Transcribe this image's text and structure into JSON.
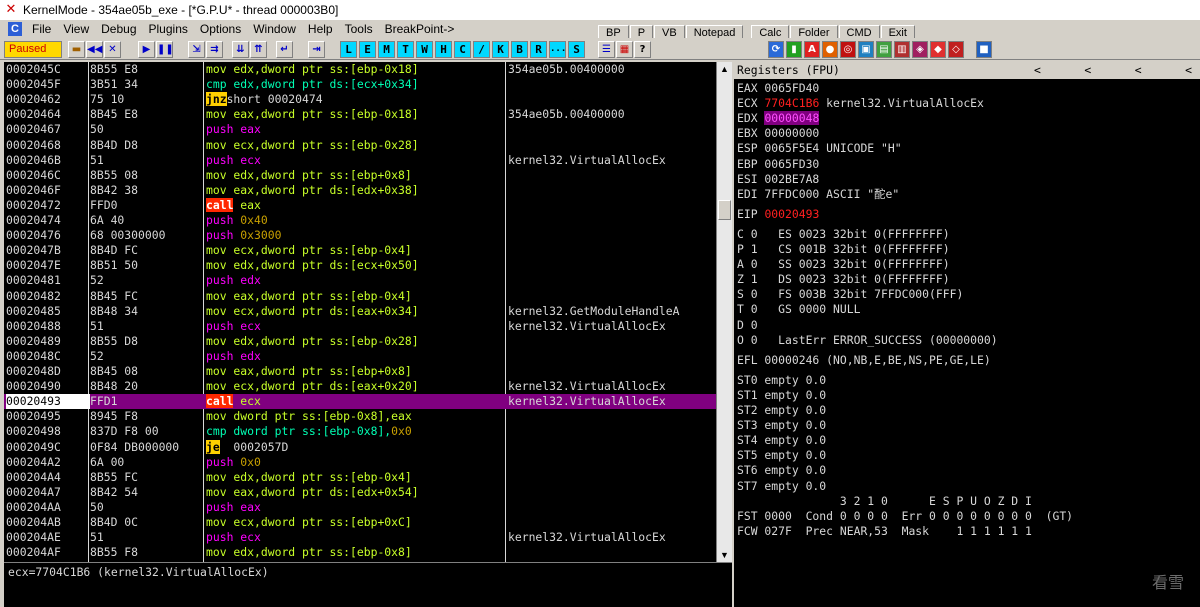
{
  "window": {
    "title": "KernelMode - 354ae05b_exe - [*G.P.U* - thread 000003B0]"
  },
  "menu": [
    "File",
    "View",
    "Debug",
    "Plugins",
    "Options",
    "Window",
    "Help",
    "Tools",
    "BreakPoint->"
  ],
  "toolbar": {
    "status": "Paused",
    "letters": [
      "L",
      "E",
      "M",
      "T",
      "W",
      "H",
      "C",
      "/",
      "K",
      "B",
      "R",
      "...",
      "S"
    ],
    "function_buttons": [
      "BP",
      "P",
      "VB",
      "Notepad",
      "Calc",
      "Folder",
      "CMD",
      "Exit"
    ]
  },
  "disasm": [
    {
      "addr": "0002045C",
      "hex": "8B55 E8",
      "ins": [
        [
          "mov",
          "mov"
        ],
        [
          "mov",
          " edx,dword ptr ss:[ebp-0x18]"
        ]
      ],
      "cmt": "354ae05b.00400000"
    },
    {
      "addr": "0002045F",
      "hex": "3B51 34",
      "ins": [
        [
          "cmp",
          "cmp"
        ],
        [
          "cmp",
          " edx,dword ptr ds:[ecx+0x34]"
        ]
      ],
      "cmt": ""
    },
    {
      "addr": "00020462",
      "hex": "75 10",
      "ins": [
        [
          "jmp",
          "jnz"
        ],
        [
          "",
          "short 00020474"
        ]
      ],
      "cmt": "",
      "arrow": true
    },
    {
      "addr": "00020464",
      "hex": "8B45 E8",
      "ins": [
        [
          "mov",
          "mov"
        ],
        [
          "mov",
          " eax,dword ptr ss:[ebp-0x18]"
        ]
      ],
      "cmt": "354ae05b.00400000"
    },
    {
      "addr": "00020467",
      "hex": "50",
      "ins": [
        [
          "push",
          "push eax"
        ]
      ],
      "cmt": ""
    },
    {
      "addr": "00020468",
      "hex": "8B4D D8",
      "ins": [
        [
          "mov",
          "mov"
        ],
        [
          "mov",
          " ecx,dword ptr ss:[ebp-0x28]"
        ]
      ],
      "cmt": ""
    },
    {
      "addr": "0002046B",
      "hex": "51",
      "ins": [
        [
          "push",
          "push ecx"
        ]
      ],
      "cmt": "kernel32.VirtualAllocEx"
    },
    {
      "addr": "0002046C",
      "hex": "8B55 08",
      "ins": [
        [
          "mov",
          "mov"
        ],
        [
          "mov",
          " edx,dword ptr ss:[ebp+0x8]"
        ]
      ],
      "cmt": ""
    },
    {
      "addr": "0002046F",
      "hex": "8B42 38",
      "ins": [
        [
          "mov",
          "mov"
        ],
        [
          "mov",
          " eax,dword ptr ds:[edx+0x38]"
        ]
      ],
      "cmt": ""
    },
    {
      "addr": "00020472",
      "hex": "FFD0",
      "ins": [
        [
          "call",
          "call"
        ],
        [
          "mov",
          " eax"
        ]
      ],
      "cmt": ""
    },
    {
      "addr": "00020474",
      "hex": "6A 40",
      "ins": [
        [
          "push",
          "push "
        ],
        [
          "num",
          "0x40"
        ]
      ],
      "cmt": ""
    },
    {
      "addr": "00020476",
      "hex": "68 00300000",
      "ins": [
        [
          "push",
          "push "
        ],
        [
          "num",
          "0x3000"
        ]
      ],
      "cmt": ""
    },
    {
      "addr": "0002047B",
      "hex": "8B4D FC",
      "ins": [
        [
          "mov",
          "mov"
        ],
        [
          "mov",
          " ecx,dword ptr ss:[ebp-0x4]"
        ]
      ],
      "cmt": ""
    },
    {
      "addr": "0002047E",
      "hex": "8B51 50",
      "ins": [
        [
          "mov",
          "mov"
        ],
        [
          "mov",
          " edx,dword ptr ds:[ecx+0x50]"
        ]
      ],
      "cmt": ""
    },
    {
      "addr": "00020481",
      "hex": "52",
      "ins": [
        [
          "push",
          "push edx"
        ]
      ],
      "cmt": ""
    },
    {
      "addr": "00020482",
      "hex": "8B45 FC",
      "ins": [
        [
          "mov",
          "mov"
        ],
        [
          "mov",
          " eax,dword ptr ss:[ebp-0x4]"
        ]
      ],
      "cmt": ""
    },
    {
      "addr": "00020485",
      "hex": "8B48 34",
      "ins": [
        [
          "mov",
          "mov"
        ],
        [
          "mov",
          " ecx,dword ptr ds:[eax+0x34]"
        ]
      ],
      "cmt": "kernel32.GetModuleHandleA"
    },
    {
      "addr": "00020488",
      "hex": "51",
      "ins": [
        [
          "push",
          "push ecx"
        ]
      ],
      "cmt": "kernel32.VirtualAllocEx"
    },
    {
      "addr": "00020489",
      "hex": "8B55 D8",
      "ins": [
        [
          "mov",
          "mov"
        ],
        [
          "mov",
          " edx,dword ptr ss:[ebp-0x28]"
        ]
      ],
      "cmt": ""
    },
    {
      "addr": "0002048C",
      "hex": "52",
      "ins": [
        [
          "push",
          "push edx"
        ]
      ],
      "cmt": ""
    },
    {
      "addr": "0002048D",
      "hex": "8B45 08",
      "ins": [
        [
          "mov",
          "mov"
        ],
        [
          "mov",
          " eax,dword ptr ss:[ebp+0x8]"
        ]
      ],
      "cmt": ""
    },
    {
      "addr": "00020490",
      "hex": "8B48 20",
      "ins": [
        [
          "mov",
          "mov"
        ],
        [
          "mov",
          " ecx,dword ptr ds:[eax+0x20]"
        ]
      ],
      "cmt": "kernel32.VirtualAllocEx"
    },
    {
      "addr": "00020493",
      "hex": "FFD1",
      "ins": [
        [
          "call",
          "call"
        ],
        [
          "mov",
          " ecx"
        ]
      ],
      "cmt": "kernel32.VirtualAllocEx",
      "selected": true
    },
    {
      "addr": "00020495",
      "hex": "8945 F8",
      "ins": [
        [
          "mov",
          "mov"
        ],
        [
          "mov",
          " dword ptr ss:[ebp-0x8],eax"
        ]
      ],
      "cmt": ""
    },
    {
      "addr": "00020498",
      "hex": "837D F8 00",
      "ins": [
        [
          "cmp",
          "cmp"
        ],
        [
          "cmp",
          " dword ptr ss:[ebp-0x8],"
        ],
        [
          "num",
          "0x0"
        ]
      ],
      "cmt": ""
    },
    {
      "addr": "0002049C",
      "hex": "0F84 DB000000",
      "ins": [
        [
          "jmp",
          "je"
        ],
        [
          "",
          "  0002057D"
        ]
      ],
      "cmt": ""
    },
    {
      "addr": "000204A2",
      "hex": "6A 00",
      "ins": [
        [
          "push",
          "push "
        ],
        [
          "num",
          "0x0"
        ]
      ],
      "cmt": ""
    },
    {
      "addr": "000204A4",
      "hex": "8B55 FC",
      "ins": [
        [
          "mov",
          "mov"
        ],
        [
          "mov",
          " edx,dword ptr ss:[ebp-0x4]"
        ]
      ],
      "cmt": ""
    },
    {
      "addr": "000204A7",
      "hex": "8B42 54",
      "ins": [
        [
          "mov",
          "mov"
        ],
        [
          "mov",
          " eax,dword ptr ds:[edx+0x54]"
        ]
      ],
      "cmt": ""
    },
    {
      "addr": "000204AA",
      "hex": "50",
      "ins": [
        [
          "push",
          "push eax"
        ]
      ],
      "cmt": ""
    },
    {
      "addr": "000204AB",
      "hex": "8B4D 0C",
      "ins": [
        [
          "mov",
          "mov"
        ],
        [
          "mov",
          " ecx,dword ptr ss:[ebp+0xC]"
        ]
      ],
      "cmt": ""
    },
    {
      "addr": "000204AE",
      "hex": "51",
      "ins": [
        [
          "push",
          "push ecx"
        ]
      ],
      "cmt": "kernel32.VirtualAllocEx"
    },
    {
      "addr": "000204AF",
      "hex": "8B55 F8",
      "ins": [
        [
          "mov",
          "mov"
        ],
        [
          "mov",
          " edx,dword ptr ss:[ebp-0x8]"
        ]
      ],
      "cmt": ""
    }
  ],
  "info_line": "ecx=7704C1B6 (kernel32.VirtualAllocEx)",
  "registers": {
    "header": "Registers (FPU)",
    "header_arrows": [
      "<",
      "<",
      "<",
      "<"
    ],
    "lines": [
      {
        "parts": [
          [
            "",
            "EAX 0065FD40"
          ]
        ]
      },
      {
        "parts": [
          [
            "",
            "ECX "
          ],
          [
            "red",
            "7704C1B6"
          ],
          [
            "",
            " kernel32.VirtualAllocEx"
          ]
        ]
      },
      {
        "parts": [
          [
            "",
            "EDX "
          ],
          [
            "hl",
            "00000048"
          ]
        ]
      },
      {
        "parts": [
          [
            "",
            "EBX 00000000"
          ]
        ]
      },
      {
        "parts": [
          [
            "",
            "ESP 0065F5E4 UNICODE \"H\""
          ]
        ]
      },
      {
        "parts": [
          [
            "",
            "EBP 0065FD30"
          ]
        ]
      },
      {
        "parts": [
          [
            "",
            "ESI 002BE7A8"
          ]
        ]
      },
      {
        "parts": [
          [
            "",
            "EDI 7FFDC000 ASCII \"酡e\""
          ]
        ]
      },
      {
        "gap": true
      },
      {
        "parts": [
          [
            "",
            "EIP "
          ],
          [
            "red",
            "00020493"
          ]
        ]
      },
      {
        "gap": true
      },
      {
        "parts": [
          [
            "",
            "C 0   ES 0023 32bit 0(FFFFFFFF)"
          ]
        ]
      },
      {
        "parts": [
          [
            "",
            "P 1   CS 001B 32bit 0(FFFFFFFF)"
          ]
        ]
      },
      {
        "parts": [
          [
            "",
            "A 0   SS 0023 32bit 0(FFFFFFFF)"
          ]
        ]
      },
      {
        "parts": [
          [
            "",
            "Z 1   DS 0023 32bit 0(FFFFFFFF)"
          ]
        ]
      },
      {
        "parts": [
          [
            "",
            "S 0   FS 003B 32bit 7FFDC000(FFF)"
          ]
        ]
      },
      {
        "parts": [
          [
            "",
            "T 0   GS 0000 NULL"
          ]
        ]
      },
      {
        "parts": [
          [
            "",
            "D 0"
          ]
        ]
      },
      {
        "parts": [
          [
            "",
            "O 0   LastErr ERROR_SUCCESS (00000000)"
          ]
        ]
      },
      {
        "gap": true
      },
      {
        "parts": [
          [
            "",
            "EFL 00000246 (NO,NB,E,BE,NS,PE,GE,LE)"
          ]
        ]
      },
      {
        "gap": true
      },
      {
        "parts": [
          [
            "",
            "ST0 empty 0.0"
          ]
        ]
      },
      {
        "parts": [
          [
            "",
            "ST1 empty 0.0"
          ]
        ]
      },
      {
        "parts": [
          [
            "",
            "ST2 empty 0.0"
          ]
        ]
      },
      {
        "parts": [
          [
            "",
            "ST3 empty 0.0"
          ]
        ]
      },
      {
        "parts": [
          [
            "",
            "ST4 empty 0.0"
          ]
        ]
      },
      {
        "parts": [
          [
            "",
            "ST5 empty 0.0"
          ]
        ]
      },
      {
        "parts": [
          [
            "",
            "ST6 empty 0.0"
          ]
        ]
      },
      {
        "parts": [
          [
            "",
            "ST7 empty 0.0"
          ]
        ]
      },
      {
        "parts": [
          [
            "",
            "               3 2 1 0      E S P U O Z D I"
          ]
        ]
      },
      {
        "parts": [
          [
            "",
            "FST 0000  Cond 0 0 0 0  Err 0 0 0 0 0 0 0 0  (GT)"
          ]
        ]
      },
      {
        "parts": [
          [
            "",
            "FCW 027F  Prec NEAR,53  Mask    1 1 1 1 1 1"
          ]
        ]
      }
    ]
  },
  "watermark": "看雪"
}
